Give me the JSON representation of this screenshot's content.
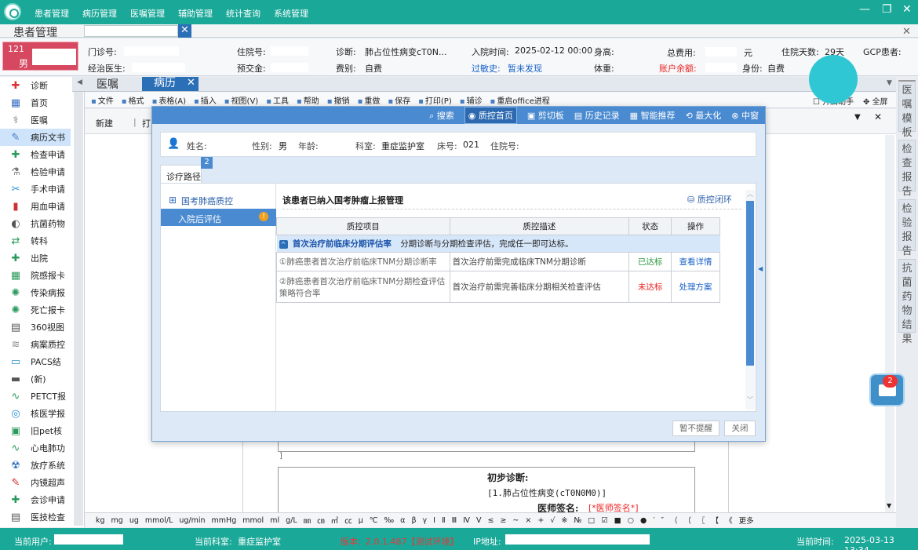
{
  "menu": [
    "患者管理",
    "病历管理",
    "医嘱管理",
    "辅助管理",
    "统计查询",
    "系统管理"
  ],
  "tab1": {
    "title": "患者管理"
  },
  "patient": {
    "bed": "121",
    "sex": "男",
    "outpatient_label": "门诊号:",
    "inpatient_label": "住院号:",
    "diagnosis_label": "诊断:",
    "diagnosis": "肺占位性病变cT0N...",
    "admit_label": "入院时间:",
    "admit_time": "2025-02-12 00:00",
    "height_label": "身高:",
    "total_fee_label": "总费用:",
    "unit": "元",
    "days_label": "住院天数:",
    "days": "29天",
    "gcp_label": "GCP患者:",
    "doctor_label": "经治医生:",
    "deposit_label": "预交金:",
    "fee_type_label": "费别:",
    "fee_type": "自费",
    "allergy_label": "过敏史:",
    "allergy": "暂未发现",
    "weight_label": "体重:",
    "balance_label": "账户余额:",
    "identity_label": "身份:",
    "identity": "自费"
  },
  "left_menu": [
    {
      "label": "诊断",
      "icon": "diagnosis-icon",
      "glyph": "✚",
      "color": "#d33"
    },
    {
      "label": "首页",
      "icon": "homepage-icon",
      "glyph": "▦",
      "color": "#3a6fc2"
    },
    {
      "label": "医嘱",
      "icon": "order-icon",
      "glyph": "⚕",
      "color": "#777"
    },
    {
      "label": "病历文书",
      "icon": "record-icon",
      "glyph": "✎",
      "color": "#4a7ec2"
    },
    {
      "label": "检查申请",
      "icon": "exam-icon",
      "glyph": "✚",
      "color": "#2a9a5c"
    },
    {
      "label": "检验申请",
      "icon": "lab-icon",
      "glyph": "⚗",
      "color": "#777"
    },
    {
      "label": "手术申请",
      "icon": "scissors-icon",
      "glyph": "✂",
      "color": "#2a8fd0"
    },
    {
      "label": "用血申请",
      "icon": "blood-icon",
      "glyph": "▮",
      "color": "#c33"
    },
    {
      "label": "抗菌药物",
      "icon": "pill-icon",
      "glyph": "◐",
      "color": "#555"
    },
    {
      "label": "转科",
      "icon": "transfer-icon",
      "glyph": "⇄",
      "color": "#2a9a5c"
    },
    {
      "label": "出院",
      "icon": "discharge-icon",
      "glyph": "✚",
      "color": "#2a9a5c"
    },
    {
      "label": "院感报卡",
      "icon": "infection-icon",
      "glyph": "▦",
      "color": "#2a9a5c"
    },
    {
      "label": "传染病报",
      "icon": "virus-icon",
      "glyph": "✺",
      "color": "#2a9a5c"
    },
    {
      "label": "死亡报卡",
      "icon": "death-icon",
      "glyph": "✺",
      "color": "#2a9a5c"
    },
    {
      "label": "360视图",
      "icon": "view360-icon",
      "glyph": "▤",
      "color": "#555"
    },
    {
      "label": "病案质控",
      "icon": "qc-icon",
      "glyph": "≋",
      "color": "#888"
    },
    {
      "label": "PACS结",
      "icon": "pacs-icon",
      "glyph": "▭",
      "color": "#2a8fd0"
    },
    {
      "label": "(新)",
      "icon": "new-icon",
      "glyph": "▬",
      "color": "#555"
    },
    {
      "label": "PETCT报",
      "icon": "petct-icon",
      "glyph": "∿",
      "color": "#2a9a5c"
    },
    {
      "label": "核医学报",
      "icon": "nuclear-icon",
      "glyph": "◎",
      "color": "#2a8fd0"
    },
    {
      "label": "旧pet核",
      "icon": "oldpet-icon",
      "glyph": "▣",
      "color": "#2a9a5c"
    },
    {
      "label": "心电肺功",
      "icon": "ecg-icon",
      "glyph": "∿",
      "color": "#2a9a5c"
    },
    {
      "label": "放疗系统",
      "icon": "radiation-icon",
      "glyph": "☢",
      "color": "#2a6fb7"
    },
    {
      "label": "内镜超声",
      "icon": "endoscope-icon",
      "glyph": "✎",
      "color": "#c33"
    },
    {
      "label": "会诊申请",
      "icon": "consult-icon",
      "glyph": "✚",
      "color": "#2a9a5c"
    },
    {
      "label": "医技检查",
      "icon": "techcheck-icon",
      "glyph": "▤",
      "color": "#555"
    }
  ],
  "right_tabs": [
    "医嘱模板",
    "检查报告",
    "检验报告",
    "抗菌药物结果"
  ],
  "tab2": {
    "a": "医嘱",
    "b": "病历"
  },
  "toolbar": [
    "文件",
    "格式",
    "表格(A)",
    "插入",
    "视图(V)",
    "工具",
    "帮助",
    "撤销",
    "重做",
    "保存",
    "打印(P)",
    "辅诊",
    "重启office进程"
  ],
  "toolbar_right": [
    "开启助手",
    "全屏"
  ],
  "ribbon": {
    "new": "新建",
    "print": "打"
  },
  "doc": {
    "prelim_label": "初步诊断:",
    "prelim_value": "[1.肺占位性病变(cT0N0M0)]",
    "sign_label": "医师签名:",
    "sign_value": "[*医师签名*]"
  },
  "symbols": [
    "kg",
    "mg",
    "ug",
    "mmol/L",
    "ug/min",
    "mmHg",
    "mmol",
    "ml",
    "g/L",
    "㎜",
    "㎝",
    "㎡",
    "㏄",
    "μ",
    "℃",
    "‰",
    "α",
    "β",
    "γ",
    "Ⅰ",
    "Ⅱ",
    "Ⅲ",
    "Ⅳ",
    "Ⅴ",
    "≤",
    "≥",
    "~",
    "×",
    "+",
    "√",
    "※",
    "№",
    "□",
    "☑",
    "■",
    "○",
    "●",
    "′",
    "″",
    "（",
    "〔",
    "〖",
    "【",
    "《",
    "更多"
  ],
  "status": {
    "user_label": "当前用户:",
    "dept_label": "当前科室:",
    "dept": "重症监护室",
    "version_label": "版本:",
    "version": "2.0.1.487【测试环境】",
    "ip_label": "IP地址:",
    "time_label": "当前时间:",
    "time": "2025-03-13 13:34"
  },
  "mail_count": "2",
  "dialog": {
    "bar": [
      "搜索",
      "质控首页",
      "剪切板",
      "历史记录",
      "智能推荐",
      "最大化",
      "中窗"
    ],
    "name_label": "姓名:",
    "sex_label": "性别:",
    "sex": "男",
    "age_label": "年龄:",
    "dept_label": "科室:",
    "dept": "重症监护室",
    "bed_label": "床号:",
    "bed": "021",
    "inpatient_label": "住院号:",
    "tab": "诊疗路径",
    "tab_count": "2",
    "tree_root": "国考肺癌质控",
    "tree_child": "入院后评估",
    "header": "该患者已纳入国考肿瘤上报管理",
    "qc_close": "质控闭环",
    "cols": [
      "质控项目",
      "质控描述",
      "状态",
      "操作"
    ],
    "group_title": "首次治疗前临床分期评估率",
    "group_desc": "分期诊断与分期检查评估，完成任一即可达标。",
    "rows": [
      {
        "item": "①肺癌患者首次治疗前临床TNM分期诊断率",
        "desc": "首次治疗前需完成临床TNM分期诊断",
        "status": "已达标",
        "status_color": "#2a9a3c",
        "op": "查看详情"
      },
      {
        "item": "②肺癌患者首次治疗前临床TNM分期检查评估策略符合率",
        "desc": "首次治疗前需完善临床分期相关检查评估",
        "status": "未达标",
        "status_color": "#e22",
        "op": "处理方案"
      }
    ],
    "btn_mute": "暂不提醒",
    "btn_close": "关闭"
  }
}
